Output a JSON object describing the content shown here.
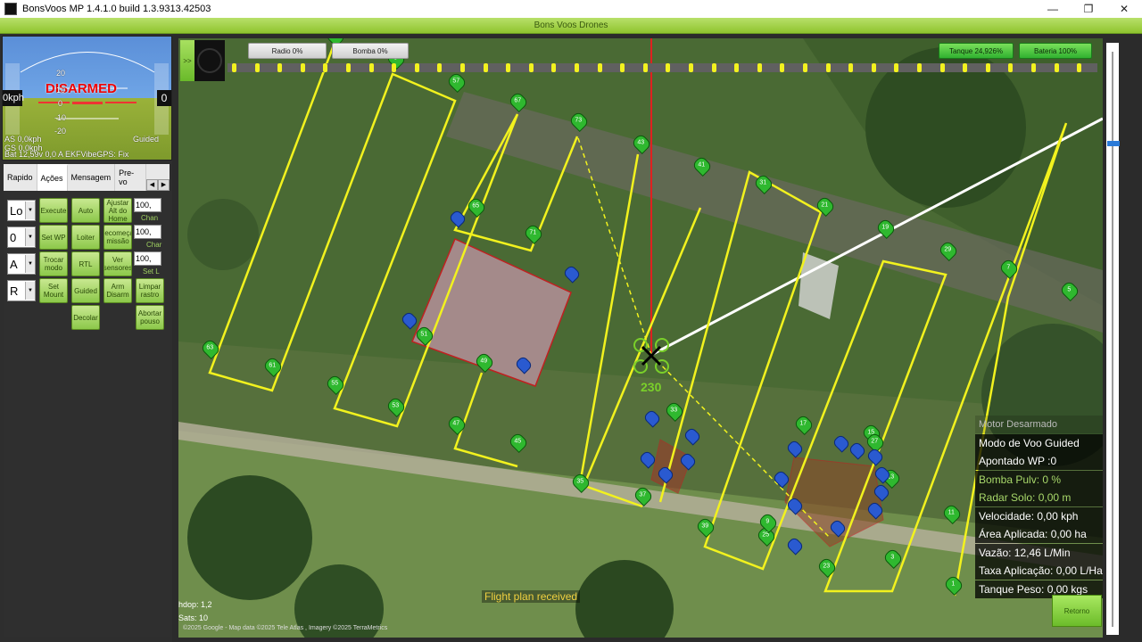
{
  "window": {
    "title": "BonsVoos MP 1.4.1.0 build 1.3.9313.42503",
    "brand": "Bons Voos Drones",
    "minimize": "—",
    "maximize": "❐",
    "close": "✕"
  },
  "hud": {
    "status": "DISARMED",
    "speed": "0kph",
    "altitude": "0",
    "scale_labels": [
      "20",
      "10",
      "0",
      "-10",
      "-20"
    ],
    "left_label": "AS 0,0kph",
    "left_label2": "GS 0,0kph",
    "right_label": "Guided",
    "bottom_line": "Bat 12,59v 0,0 A EKFVibeGPS: Fix",
    "accent": "#e00000"
  },
  "tabs": {
    "items": [
      {
        "label": "Rapido"
      },
      {
        "label": "Ações"
      },
      {
        "label": "Mensagem"
      },
      {
        "label": "Pre-vo"
      }
    ],
    "active": "Ações"
  },
  "actions": {
    "combos": [
      "Lo",
      "0",
      "A",
      "R"
    ],
    "buttons": [
      {
        "label": "Execute"
      },
      {
        "label": "Auto"
      },
      {
        "label": "Ajustar Alt do Home"
      },
      {
        "label": "Set WP"
      },
      {
        "label": "Loiter"
      },
      {
        "label": "Recomeçar missão"
      },
      {
        "label": "Trocar modo"
      },
      {
        "label": "RTL"
      },
      {
        "label": "Ver sensores"
      },
      {
        "label": "Set Mount"
      },
      {
        "label": "Guided"
      },
      {
        "label": "Arm Disarm"
      },
      {
        "label": "Limpar rastro"
      },
      {
        "label": "Decolar"
      },
      {
        "label": "Abortar pouso"
      }
    ],
    "numbers": [
      "100,",
      "100,",
      "100,"
    ],
    "side_labels": [
      "Chan",
      "Char",
      "Set L"
    ]
  },
  "map": {
    "radio": "Radio 0%",
    "bomba": "Bomba 0%",
    "tanque": "Tanque 24,926%",
    "bateria": "Bateria 100%",
    "expand": ">>",
    "heading": "230",
    "flight_plan_msg": "Flight plan received",
    "hdop": "hdop: 1,2",
    "sats": "Sats: 10",
    "attribution": "©2025 Google - Map data ©2025 Tele Atlas , Imagery ©2025 TerraMetrics",
    "watermark": "©2025 Google",
    "retorno": "Retorno",
    "waypoints": [
      "6",
      "5",
      "57",
      "67",
      "73",
      "43",
      "41",
      "31",
      "21",
      "19",
      "29",
      "7",
      "5",
      "65",
      "71",
      "63",
      "61",
      "55",
      "53",
      "51",
      "49",
      "47",
      "45",
      "35",
      "37",
      "33",
      "39",
      "25",
      "23",
      "17",
      "15",
      "13",
      "11",
      "9",
      "3",
      "1",
      "27"
    ]
  },
  "telemetry": {
    "motor": "Motor Desarmado",
    "modo": "Modo de Voo Guided",
    "apontado": "Apontado WP :0",
    "bomba": "Bomba Pulv: 0 %",
    "radar": "Radar Solo: 0,00 m",
    "velocidade": "Velocidade: 0,00 kph",
    "area": "Área Aplicada: 0,00 ha",
    "vazao": "Vazão: 12,46 L/Min",
    "taxa": "Taxa Aplicação: 0,00 L/Ha",
    "tanque": "Tanque Peso: 0,00 kgs"
  },
  "colors": {
    "path": "#f2f21e",
    "waypoint": "#2fb82f",
    "fence": "#2a5ad0",
    "button": "#9cd35a"
  }
}
